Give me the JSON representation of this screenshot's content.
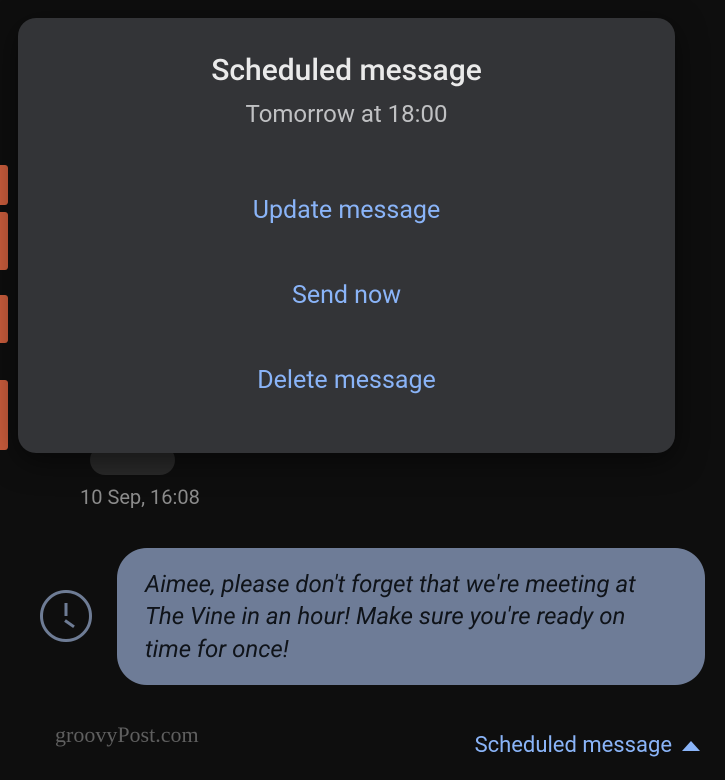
{
  "dialog": {
    "title": "Scheduled message",
    "subtitle": "Tomorrow at 18:00",
    "options": {
      "update": "Update message",
      "send": "Send now",
      "delete": "Delete message"
    }
  },
  "conversation": {
    "timestamp": "10 Sep, 16:08",
    "scheduled_message_body": "Aimee, please don't forget that we're meeting at The Vine in an hour! Make sure you're ready on time for once!"
  },
  "footer": {
    "watermark": "groovyPost.com",
    "status_label": "Scheduled message"
  }
}
